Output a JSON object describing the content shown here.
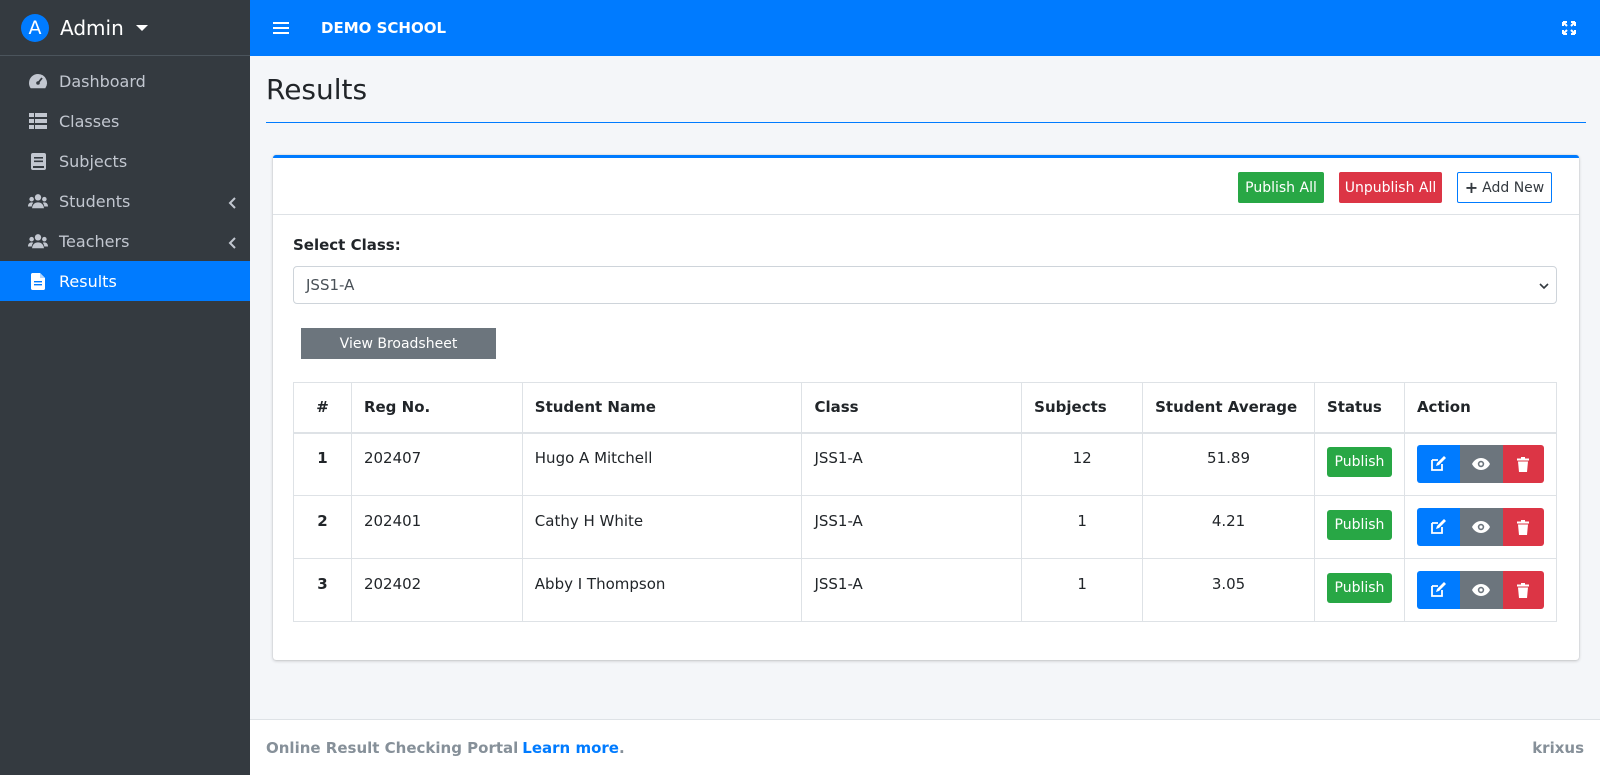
{
  "sidebar": {
    "user": {
      "initial": "A",
      "name": "Admin"
    },
    "items": [
      {
        "label": "Dashboard",
        "icon": "dashboard-icon"
      },
      {
        "label": "Classes",
        "icon": "list-icon"
      },
      {
        "label": "Subjects",
        "icon": "book-icon"
      },
      {
        "label": "Students",
        "icon": "users-icon"
      },
      {
        "label": "Teachers",
        "icon": "users-icon"
      },
      {
        "label": "Results",
        "icon": "file-icon"
      }
    ]
  },
  "topbar": {
    "school_name": "DEMO SCHOOL"
  },
  "page": {
    "title": "Results"
  },
  "card": {
    "publish_all": "Publish All",
    "unpublish_all": "Unpublish All",
    "add_new": "Add New",
    "select_label": "Select Class:",
    "selected_class": "JSS1-A",
    "view_broadsheet": "View Broadsheet"
  },
  "table": {
    "headers": [
      "#",
      "Reg No.",
      "Student Name",
      "Class",
      "Subjects",
      "Student Average",
      "Status",
      "Action"
    ],
    "rows": [
      {
        "num": "1",
        "reg": "202407",
        "name": "Hugo A Mitchell",
        "class": "JSS1-A",
        "subjects": "12",
        "average": "51.89",
        "status": "Publish"
      },
      {
        "num": "2",
        "reg": "202401",
        "name": "Cathy H White",
        "class": "JSS1-A",
        "subjects": "1",
        "average": "4.21",
        "status": "Publish"
      },
      {
        "num": "3",
        "reg": "202402",
        "name": "Abby I Thompson",
        "class": "JSS1-A",
        "subjects": "1",
        "average": "3.05",
        "status": "Publish"
      }
    ]
  },
  "footer": {
    "text": "Online Result Checking Portal",
    "link": "Learn more",
    "period": ".",
    "right": "krixus"
  },
  "colors": {
    "primary": "#007bff",
    "success": "#28a745",
    "danger": "#dc3545",
    "secondary": "#6c757d",
    "sidebar": "#343a40"
  }
}
